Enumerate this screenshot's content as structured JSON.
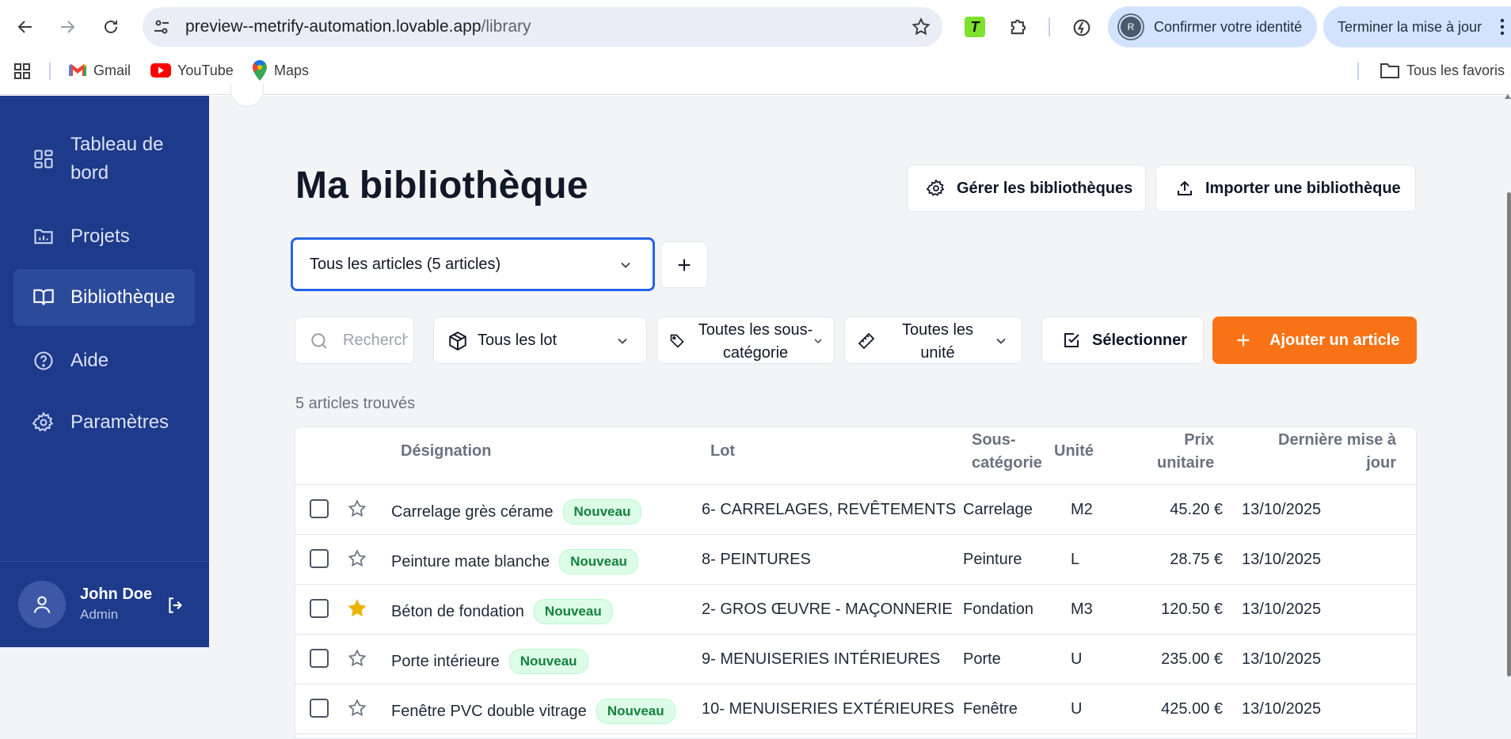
{
  "browser": {
    "url_host": "preview--metrify-automation.lovable.app",
    "url_path": "/library",
    "identity_label": "Confirmer votre identité",
    "identity_avatar_letter": "R",
    "update_label": "Terminer la mise à jour",
    "extension_t_label": "T",
    "bookmarks": [
      {
        "label": "Gmail",
        "icon": "gmail-icon"
      },
      {
        "label": "YouTube",
        "icon": "youtube-icon"
      },
      {
        "label": "Maps",
        "icon": "maps-icon"
      }
    ],
    "all_bookmarks_label": "Tous les favoris"
  },
  "sidebar": {
    "items": [
      {
        "label": "Tableau de bord",
        "icon": "dashboard-icon",
        "active": false
      },
      {
        "label": "Projets",
        "icon": "folder-chart-icon",
        "active": false
      },
      {
        "label": "Bibliothèque",
        "icon": "book-open-icon",
        "active": true
      },
      {
        "label": "Aide",
        "icon": "help-circle-icon",
        "active": false
      },
      {
        "label": "Paramètres",
        "icon": "gear-icon",
        "active": false
      }
    ],
    "user": {
      "name": "John Doe",
      "role": "Admin"
    }
  },
  "main": {
    "title": "Ma bibliothèque",
    "manage_button": "Gérer les bibliothèques",
    "import_button": "Importer une bibliothèque",
    "library_select": "Tous les articles (5 articles)",
    "search_placeholder": "Rechercher",
    "lot_filter": "Tous les lot",
    "subcategory_filter": "Toutes les sous-catégorie",
    "unit_filter": "Toutes les unité",
    "select_button": "Sélectionner",
    "add_button": "Ajouter un article",
    "count_text": "5 articles trouvés"
  },
  "table": {
    "headers": {
      "designation": "Désignation",
      "lot": "Lot",
      "sous_categorie": "Sous-catégorie",
      "unite": "Unité",
      "prix": "Prix unitaire",
      "maj": "Dernière mise à jour"
    },
    "rows": [
      {
        "designation": "Carrelage grès cérame",
        "badge": "Nouveau",
        "lot": "6- CARRELAGES, REVÊTEMENTS",
        "sous_categorie": "Carrelage",
        "unite": "M2",
        "prix": "45.20 €",
        "maj": "13/10/2025",
        "favorite": false
      },
      {
        "designation": "Peinture mate blanche",
        "badge": "Nouveau",
        "lot": "8- PEINTURES",
        "sous_categorie": "Peinture",
        "unite": "L",
        "prix": "28.75 €",
        "maj": "13/10/2025",
        "favorite": false
      },
      {
        "designation": "Béton de fondation",
        "badge": "Nouveau",
        "lot": "2- GROS ŒUVRE - MAÇONNERIE",
        "sous_categorie": "Fondation",
        "unite": "M3",
        "prix": "120.50 €",
        "maj": "13/10/2025",
        "favorite": true
      },
      {
        "designation": "Porte intérieure",
        "badge": "Nouveau",
        "lot": "9- MENUISERIES INTÉRIEURES",
        "sous_categorie": "Porte",
        "unite": "U",
        "prix": "235.00 €",
        "maj": "13/10/2025",
        "favorite": false
      },
      {
        "designation": "Fenêtre PVC double vitrage",
        "badge": "Nouveau",
        "lot": "10- MENUISERIES EXTÉRIEURES",
        "sous_categorie": "Fenêtre",
        "unite": "U",
        "prix": "425.00 €",
        "maj": "13/10/2025",
        "favorite": false
      }
    ]
  },
  "colors": {
    "sidebar_bg": "#1e3a8a",
    "accent_orange": "#f97316",
    "focus_blue": "#2563eb",
    "badge_green": "#15803d",
    "star_gold": "#eab308"
  }
}
